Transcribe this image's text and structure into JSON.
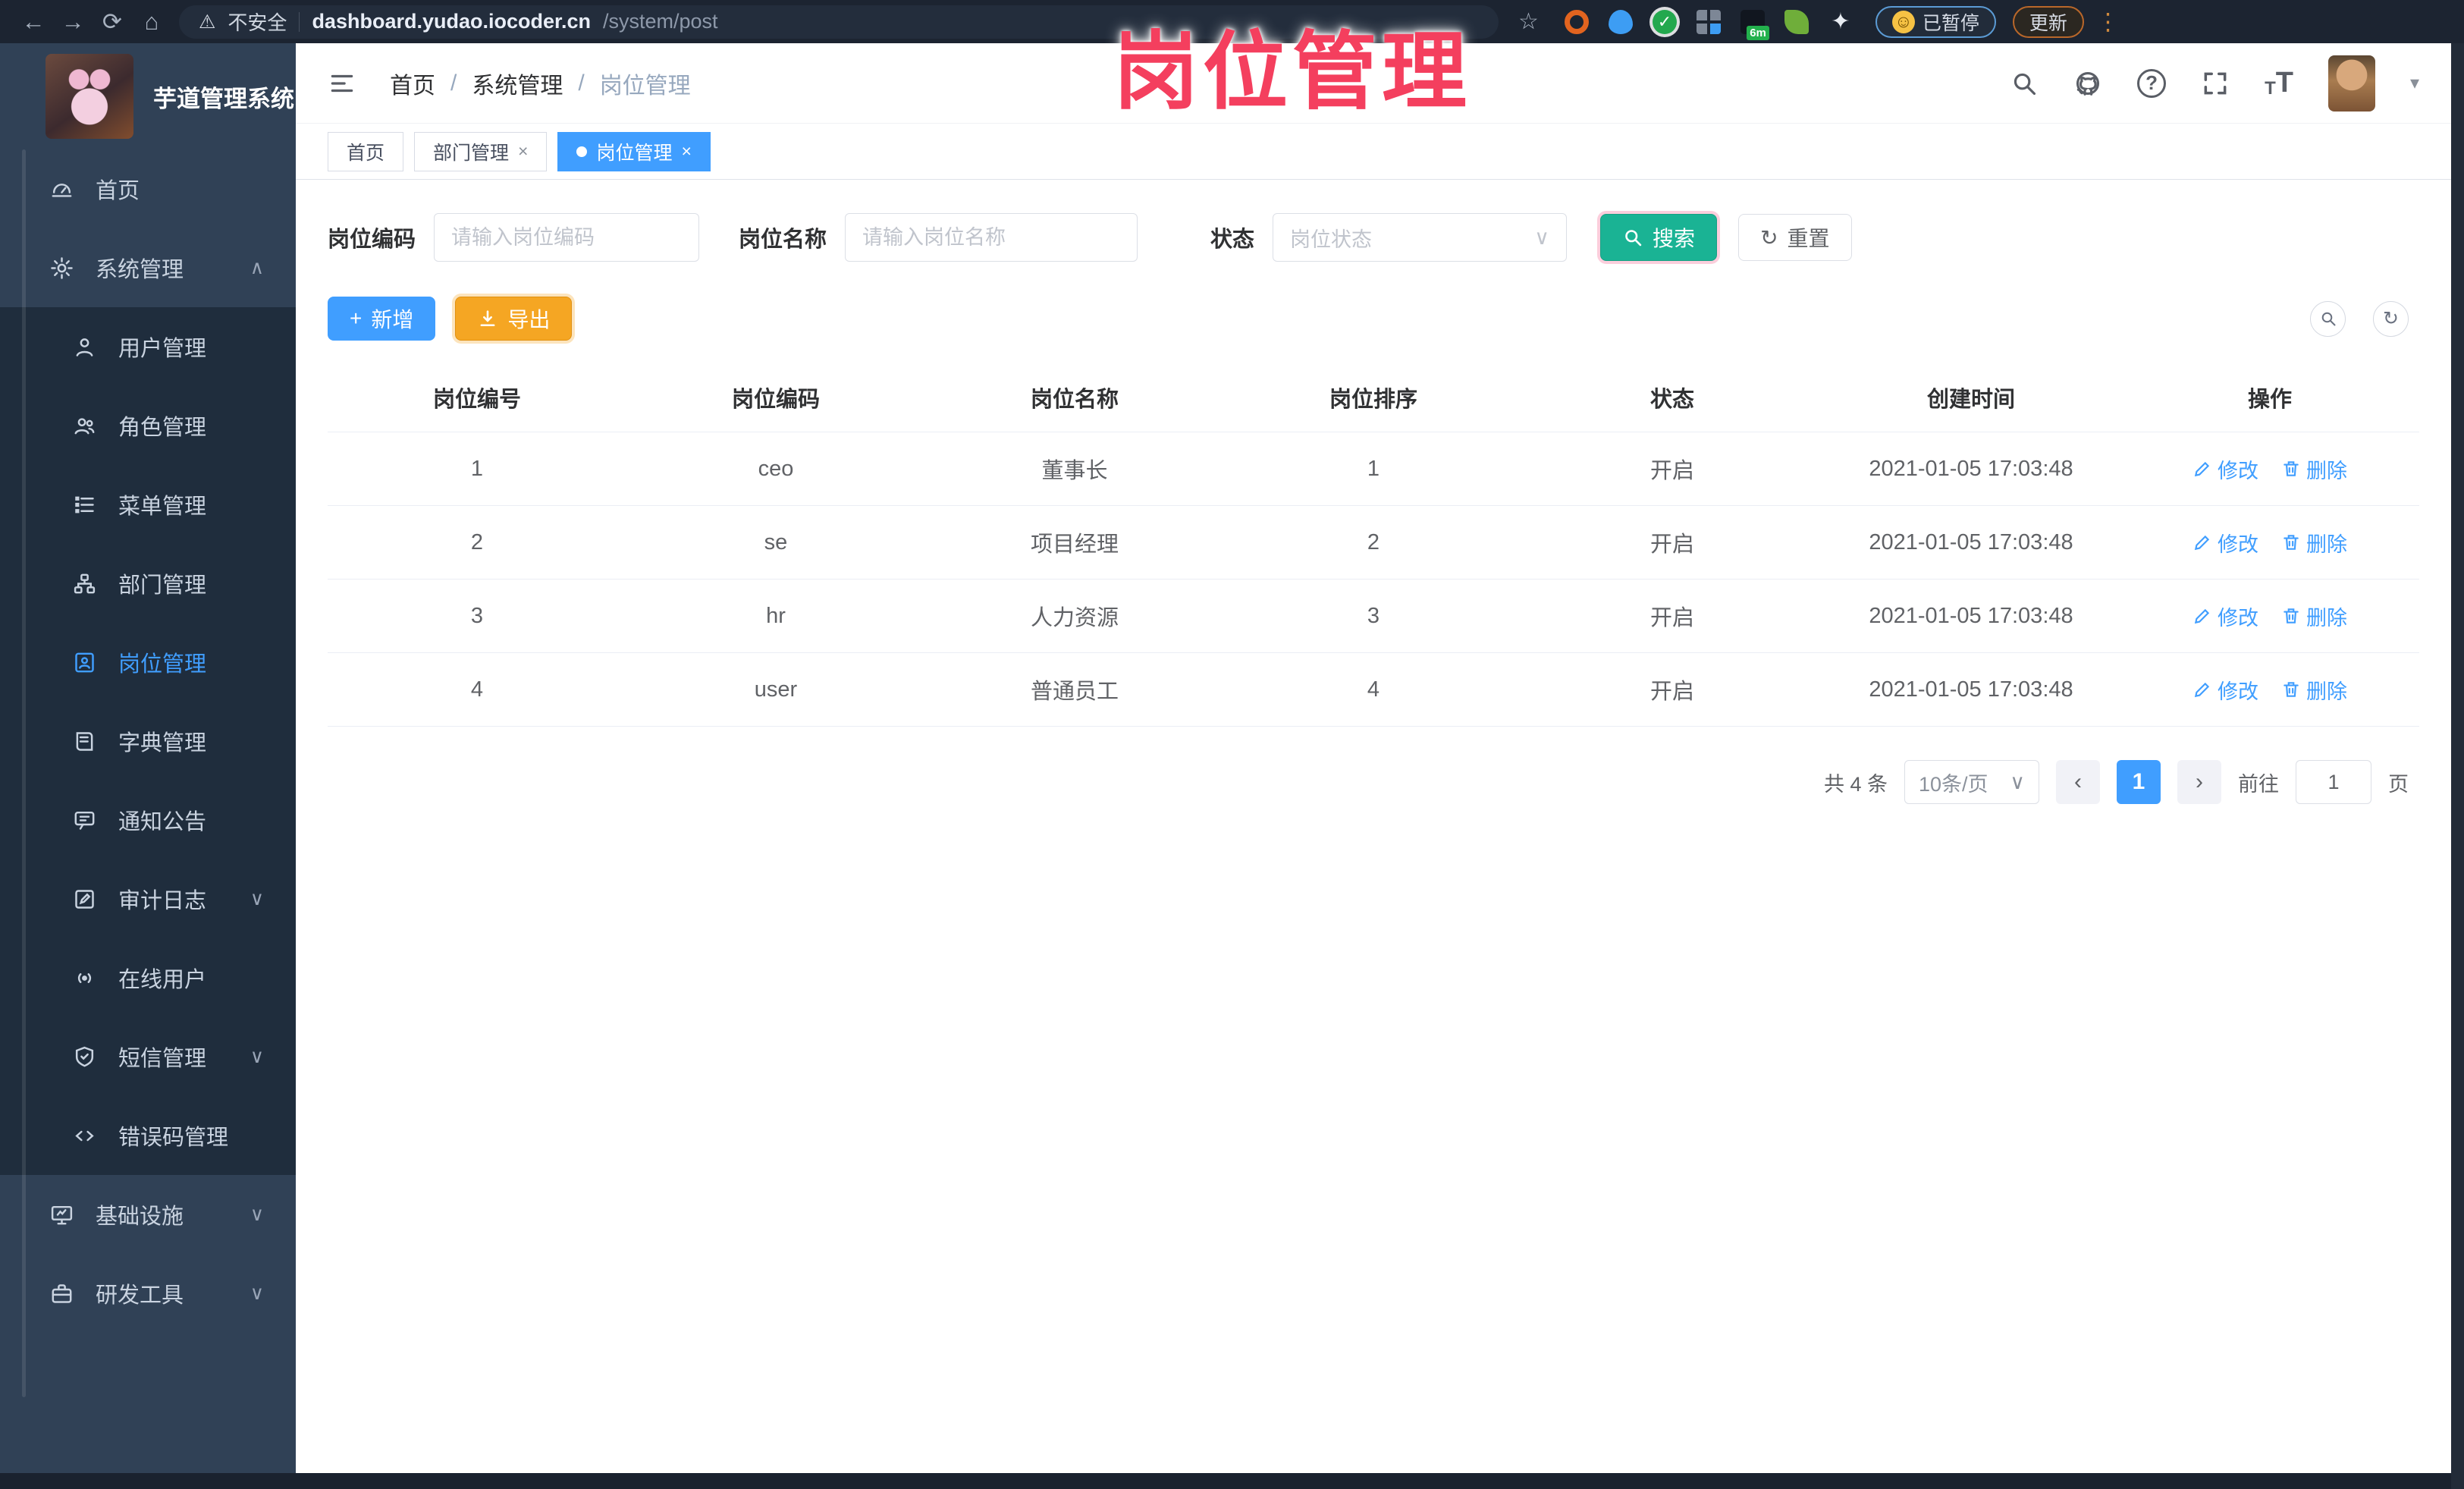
{
  "watermark": {
    "text": "岗位管理",
    "color": "#f43f5e"
  },
  "theme": {
    "accent": "#409eff",
    "search_teal": "#1ab394",
    "warning_orange": "#f5a623",
    "sidebar_bg": "#304156",
    "submenu_bg": "#1f2d3d",
    "chrome_bg": "#1c2431"
  },
  "icons": {
    "back": "←",
    "forward": "→",
    "reload": "⟳",
    "home": "⌂",
    "warning": "⚠",
    "star": "☆",
    "puzzle": "✦",
    "smiley": "☺",
    "dots_v": "⋮",
    "caret_down": "▾",
    "chev_up": "∧",
    "chev_down": "∨",
    "close": "×",
    "plus": "+",
    "refresh": "↻",
    "prev": "‹",
    "next": "›",
    "question": "?",
    "font_big": "T",
    "font_small": "T",
    "check": "✓",
    "select_down": "∨"
  },
  "browser": {
    "security_label": "不安全",
    "url_host": "dashboard.yudao.iocoder.cn",
    "url_path": "/system/post",
    "ext_badge": "6m",
    "paused_label": "已暂停",
    "update_label": "更新"
  },
  "sidebar": {
    "title": "芋道管理系统",
    "home": "首页",
    "system": "系统管理",
    "system_children": [
      "用户管理",
      "角色管理",
      "菜单管理",
      "部门管理",
      "岗位管理",
      "字典管理",
      "通知公告",
      "审计日志",
      "在线用户",
      "短信管理",
      "错误码管理"
    ],
    "infra": "基础设施",
    "devtools": "研发工具"
  },
  "header": {
    "breadcrumb": [
      "首页",
      "系统管理",
      "岗位管理"
    ],
    "separator": "/"
  },
  "tabs": {
    "t0": "首页",
    "t1": "部门管理",
    "t2": "岗位管理"
  },
  "filters": {
    "code_label": "岗位编码",
    "code_placeholder": "请输入岗位编码",
    "name_label": "岗位名称",
    "name_placeholder": "请输入岗位名称",
    "status_label": "状态",
    "status_placeholder": "岗位状态",
    "search_label": "搜索",
    "reset_label": "重置"
  },
  "toolbar": {
    "add_label": "新增",
    "export_label": "导出"
  },
  "table": {
    "columns": [
      "岗位编号",
      "岗位编码",
      "岗位名称",
      "岗位排序",
      "状态",
      "创建时间",
      "操作"
    ],
    "ops": {
      "edit": "修改",
      "delete": "删除"
    },
    "rows": [
      {
        "id": "1",
        "code": "ceo",
        "name": "董事长",
        "sort": "1",
        "status": "开启",
        "created": "2021-01-05 17:03:48"
      },
      {
        "id": "2",
        "code": "se",
        "name": "项目经理",
        "sort": "2",
        "status": "开启",
        "created": "2021-01-05 17:03:48"
      },
      {
        "id": "3",
        "code": "hr",
        "name": "人力资源",
        "sort": "3",
        "status": "开启",
        "created": "2021-01-05 17:03:48"
      },
      {
        "id": "4",
        "code": "user",
        "name": "普通员工",
        "sort": "4",
        "status": "开启",
        "created": "2021-01-05 17:03:48"
      }
    ]
  },
  "pagination": {
    "total": "共 4 条",
    "page_size": "10条/页",
    "current": "1",
    "goto_label": "前往",
    "goto_value": "1",
    "page_suffix": "页"
  }
}
